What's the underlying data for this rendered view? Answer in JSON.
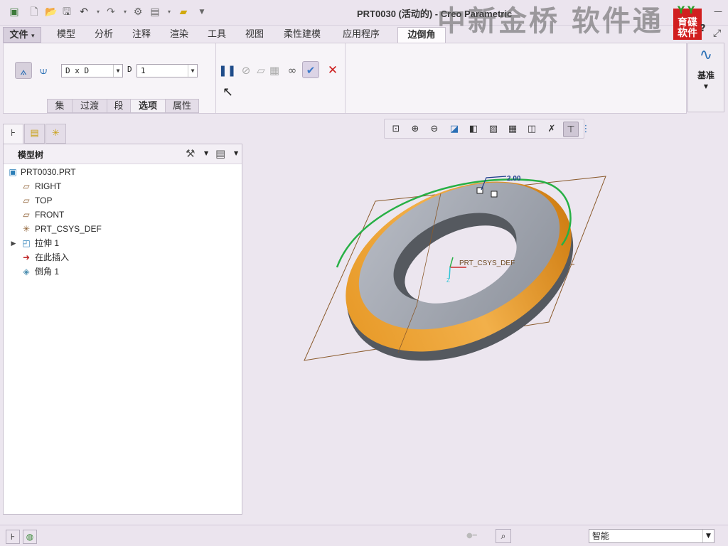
{
  "window": {
    "title": "PRT0030 (活动的) - Creo Parametric",
    "watermark": "中新金桥 软件通",
    "brand_logo_text": [
      "育碟",
      "软件"
    ],
    "brand_logo_top": "YY"
  },
  "quick_access": {
    "icons": [
      "app-icon",
      "new-icon",
      "open-icon",
      "save-icon",
      "undo-icon",
      "redo-icon",
      "regenerate-icon",
      "windows-icon",
      "close-window-icon",
      "customize-icon"
    ]
  },
  "ribbon": {
    "tabs": [
      "文件",
      "模型",
      "分析",
      "注释",
      "渲染",
      "工具",
      "视图",
      "柔性建模",
      "应用程序",
      "边倒角"
    ],
    "file_menu_arrow": "▾",
    "active_tab": "边倒角",
    "dimension_scheme": "D x D",
    "d_label": "D",
    "d_value": "1",
    "subtabs": [
      "集",
      "过渡",
      "段",
      "选项",
      "属性"
    ],
    "active_subtab": "选项",
    "datum_label": "基准"
  },
  "model_tree": {
    "title": "模型树",
    "items": [
      {
        "label": "PRT0030.PRT",
        "icon": "part-icon"
      },
      {
        "label": "RIGHT",
        "icon": "datum-plane-icon"
      },
      {
        "label": "TOP",
        "icon": "datum-plane-icon"
      },
      {
        "label": "FRONT",
        "icon": "datum-plane-icon"
      },
      {
        "label": "PRT_CSYS_DEF",
        "icon": "csys-icon"
      },
      {
        "label": "拉伸 1",
        "icon": "extrude-icon"
      },
      {
        "label": "在此插入",
        "icon": "insert-here-icon"
      },
      {
        "label": "倒角 1",
        "icon": "chamfer-icon"
      }
    ]
  },
  "viewport": {
    "dimension_label": "2.00",
    "csys_label": "PRT_CSYS_DEF",
    "axis_z": "Z",
    "accent_color": "#e2901a",
    "gray_color": "#9da2ad"
  },
  "status": {
    "filter": "智能"
  }
}
